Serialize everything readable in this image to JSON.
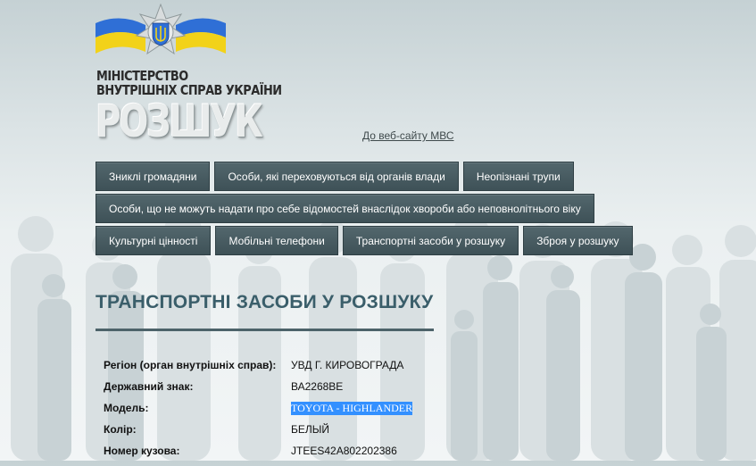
{
  "header": {
    "ministry_line1": "МІНІСТЕРСТВО",
    "ministry_line2": "ВНУТРІШНІХ СПРАВ УКРАЇНИ",
    "brand": "РОЗШУК",
    "mvs_link": "До веб-сайту МВС",
    "flag_colors": {
      "blue": "#2f6fd6",
      "yellow": "#f2d219"
    }
  },
  "nav": {
    "row1": [
      "Зниклі громадяни",
      "Особи, які переховуються від органів влади",
      "Неопізнані трупи"
    ],
    "row2": [
      "Особи, що не можуть надати про себе відомостей внаслідок хвороби або неповнолітнього віку"
    ],
    "row3": [
      "Культурні цінності",
      "Мобільні телефони",
      "Транспортні засоби у розшуку",
      "Зброя у розшуку"
    ]
  },
  "section": {
    "title": "ТРАНСПОРТНІ ЗАСОБИ У РОЗШУКУ"
  },
  "details": [
    {
      "label": "Регіон (орган внутрішніх справ):",
      "value": "УВД Г. КИРОВОГРАДА"
    },
    {
      "label": "Державний знак:",
      "value": "ВА2268ВЕ"
    },
    {
      "label": "Модель:",
      "value": "TOYOTA - HIGHLANDER"
    },
    {
      "label": "Колір:",
      "value": "БЕЛЫЙ"
    },
    {
      "label": "Номер кузова:",
      "value": "JTEES42A802202386"
    }
  ],
  "colors": {
    "nav_bg": "#46595f",
    "title": "#3a5e6a",
    "selection": "#3390ff"
  }
}
